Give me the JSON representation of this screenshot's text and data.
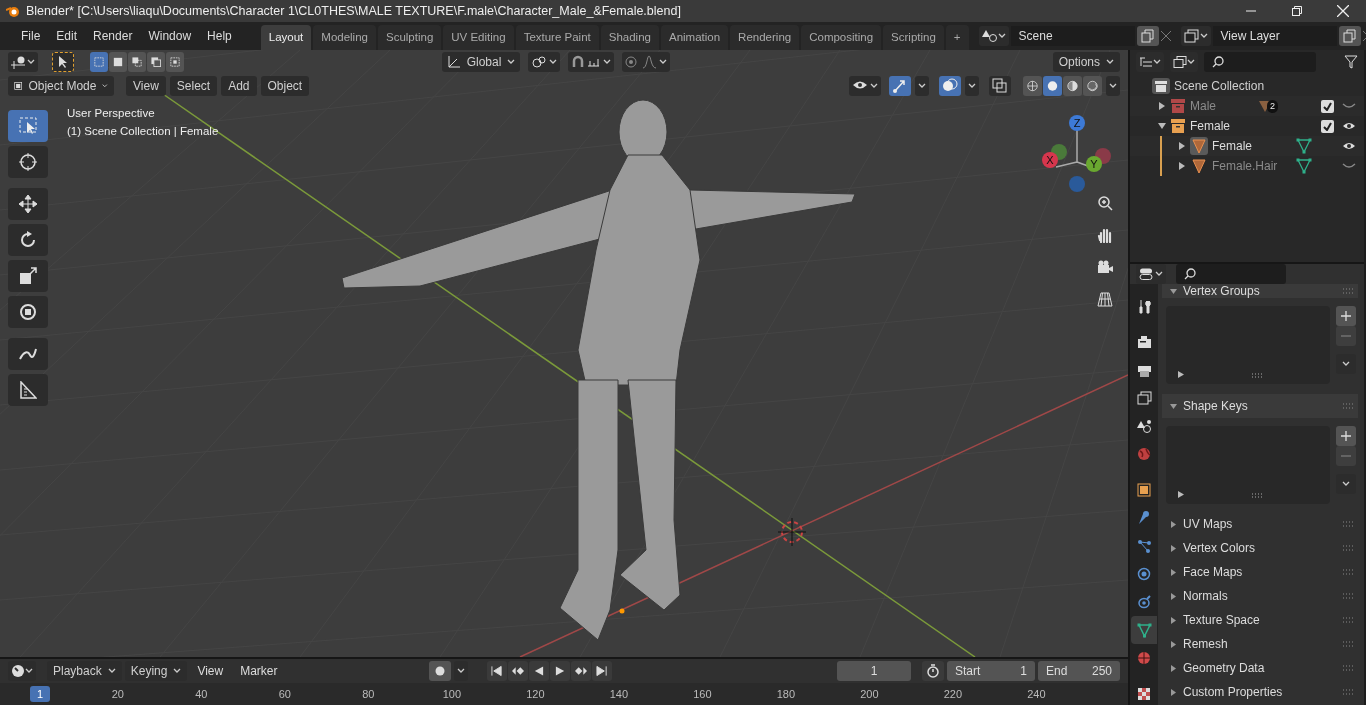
{
  "window": {
    "title": "Blender* [C:\\Users\\liaqu\\Documents\\Character 1\\CL0THES\\MALE TEXTURE\\F.male\\Character_Male_&Female.blend]"
  },
  "menu": [
    "File",
    "Edit",
    "Render",
    "Window",
    "Help"
  ],
  "workspaces": [
    {
      "label": "Layout",
      "selected": true
    },
    {
      "label": "Modeling",
      "selected": false
    },
    {
      "label": "Sculpting",
      "selected": false
    },
    {
      "label": "UV Editing",
      "selected": false
    },
    {
      "label": "Texture Paint",
      "selected": false
    },
    {
      "label": "Shading",
      "selected": false
    },
    {
      "label": "Animation",
      "selected": false
    },
    {
      "label": "Rendering",
      "selected": false
    },
    {
      "label": "Compositing",
      "selected": false
    },
    {
      "label": "Scripting",
      "selected": false
    }
  ],
  "add_workspace": "+",
  "scene": {
    "value": "Scene"
  },
  "view_layer": {
    "value": "View Layer"
  },
  "viewport_header": {
    "select_modes": [
      {
        "selected": true
      },
      {
        "selected": false
      },
      {
        "selected": false
      },
      {
        "selected": false
      },
      {
        "selected": false
      }
    ],
    "transform": "Global",
    "options": "Options",
    "mode": "Object Mode",
    "menus": [
      "View",
      "Select",
      "Add",
      "Object"
    ],
    "toggles": [
      {
        "kind": "gizmos",
        "on": true
      },
      {
        "kind": "overlays",
        "on": true
      },
      {
        "kind": "xray",
        "on": false
      }
    ],
    "shading": [
      {
        "kind": "wireframe",
        "selected": false
      },
      {
        "kind": "solid",
        "selected": true
      },
      {
        "kind": "material",
        "selected": false
      },
      {
        "kind": "rendered",
        "selected": false
      }
    ]
  },
  "viewport": {
    "perspective": "User Perspective",
    "context": "(1) Scene Collection | Female",
    "tools": [
      {
        "kind": "select",
        "selected": true
      },
      {
        "kind": "cursor",
        "selected": false
      },
      {
        "kind": "move",
        "selected": false
      },
      {
        "kind": "rotate",
        "selected": false
      },
      {
        "kind": "scale",
        "selected": false
      },
      {
        "kind": "transform",
        "selected": false
      },
      {
        "kind": "annotate",
        "selected": false
      },
      {
        "kind": "measure",
        "selected": false
      }
    ],
    "axes": {
      "x": "X",
      "y": "Y",
      "z": "Z"
    }
  },
  "outliner": {
    "root": "Scene Collection",
    "items": [
      {
        "label": "Male",
        "kind": "collection",
        "expanded": false,
        "disabled": true,
        "badge": "2",
        "checked": true,
        "visible": false
      },
      {
        "label": "Female",
        "kind": "collection",
        "expanded": true,
        "disabled": false,
        "checked": true,
        "visible": true,
        "children": [
          {
            "label": "Female",
            "kind": "mesh",
            "expanded": false,
            "disabled": false,
            "active": true,
            "visible": true
          },
          {
            "label": "Female.Hair",
            "kind": "mesh",
            "expanded": false,
            "disabled": true,
            "active": false,
            "visible": false
          }
        ]
      }
    ]
  },
  "properties": {
    "tabs": [
      {
        "kind": "tool",
        "selected": false
      },
      {
        "kind": "render",
        "selected": false
      },
      {
        "kind": "output",
        "selected": false
      },
      {
        "kind": "view_layer",
        "selected": false
      },
      {
        "kind": "scene",
        "selected": false
      },
      {
        "kind": "world",
        "selected": false
      },
      {
        "kind": "object",
        "selected": false
      },
      {
        "kind": "modifiers",
        "selected": false
      },
      {
        "kind": "particles",
        "selected": false
      },
      {
        "kind": "physics",
        "selected": false
      },
      {
        "kind": "constraints",
        "selected": false
      },
      {
        "kind": "data",
        "selected": true
      },
      {
        "kind": "material",
        "selected": false
      },
      {
        "kind": "texture",
        "selected": false
      }
    ],
    "panels": [
      {
        "title": "Vertex Groups",
        "kind": "list",
        "expanded": true
      },
      {
        "title": "Shape Keys",
        "kind": "list",
        "expanded": true
      },
      {
        "title": "UV Maps",
        "kind": "plain",
        "expanded": false
      },
      {
        "title": "Vertex Colors",
        "kind": "plain",
        "expanded": false
      },
      {
        "title": "Face Maps",
        "kind": "plain",
        "expanded": false
      },
      {
        "title": "Normals",
        "kind": "plain",
        "expanded": false
      },
      {
        "title": "Texture Space",
        "kind": "plain",
        "expanded": false
      },
      {
        "title": "Remesh",
        "kind": "plain",
        "expanded": false
      },
      {
        "title": "Geometry Data",
        "kind": "plain",
        "expanded": false
      },
      {
        "title": "Custom Properties",
        "kind": "plain",
        "expanded": false
      }
    ]
  },
  "timeline": {
    "menus": [
      {
        "label": "Playback",
        "kind": "dropdown"
      },
      {
        "label": "Keying",
        "kind": "dropdown"
      },
      {
        "label": "View",
        "kind": "menu"
      },
      {
        "label": "Marker",
        "kind": "menu"
      }
    ],
    "auto_key": false,
    "current_frame": "1",
    "start_label": "Start",
    "start": "1",
    "end_label": "End",
    "end": "250",
    "ruler": [
      "1",
      "20",
      "40",
      "60",
      "80",
      "100",
      "120",
      "140",
      "160",
      "180",
      "200",
      "220",
      "240"
    ]
  }
}
